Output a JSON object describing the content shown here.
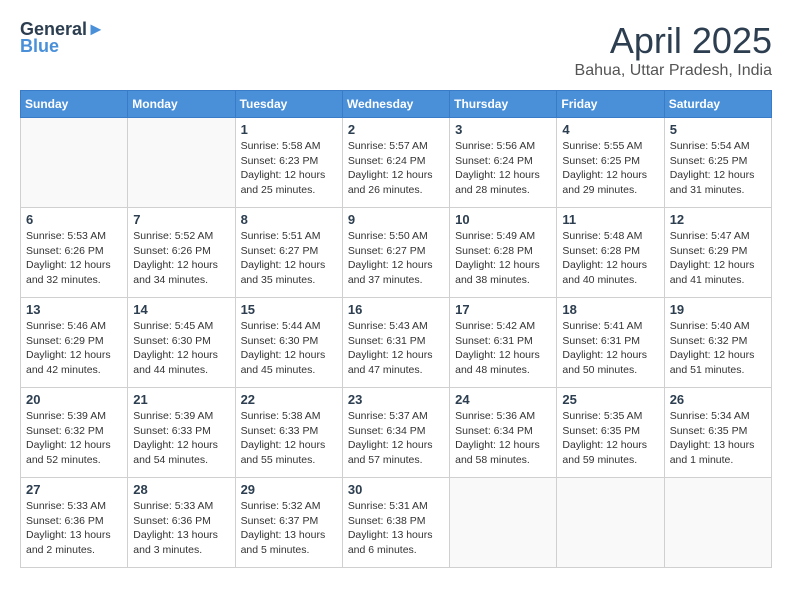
{
  "logo": {
    "line1": "General",
    "line2": "Blue"
  },
  "title": "April 2025",
  "subtitle": "Bahua, Uttar Pradesh, India",
  "days_header": [
    "Sunday",
    "Monday",
    "Tuesday",
    "Wednesday",
    "Thursday",
    "Friday",
    "Saturday"
  ],
  "weeks": [
    [
      {
        "day": "",
        "info": ""
      },
      {
        "day": "",
        "info": ""
      },
      {
        "day": "1",
        "info": "Sunrise: 5:58 AM\nSunset: 6:23 PM\nDaylight: 12 hours\nand 25 minutes."
      },
      {
        "day": "2",
        "info": "Sunrise: 5:57 AM\nSunset: 6:24 PM\nDaylight: 12 hours\nand 26 minutes."
      },
      {
        "day": "3",
        "info": "Sunrise: 5:56 AM\nSunset: 6:24 PM\nDaylight: 12 hours\nand 28 minutes."
      },
      {
        "day": "4",
        "info": "Sunrise: 5:55 AM\nSunset: 6:25 PM\nDaylight: 12 hours\nand 29 minutes."
      },
      {
        "day": "5",
        "info": "Sunrise: 5:54 AM\nSunset: 6:25 PM\nDaylight: 12 hours\nand 31 minutes."
      }
    ],
    [
      {
        "day": "6",
        "info": "Sunrise: 5:53 AM\nSunset: 6:26 PM\nDaylight: 12 hours\nand 32 minutes."
      },
      {
        "day": "7",
        "info": "Sunrise: 5:52 AM\nSunset: 6:26 PM\nDaylight: 12 hours\nand 34 minutes."
      },
      {
        "day": "8",
        "info": "Sunrise: 5:51 AM\nSunset: 6:27 PM\nDaylight: 12 hours\nand 35 minutes."
      },
      {
        "day": "9",
        "info": "Sunrise: 5:50 AM\nSunset: 6:27 PM\nDaylight: 12 hours\nand 37 minutes."
      },
      {
        "day": "10",
        "info": "Sunrise: 5:49 AM\nSunset: 6:28 PM\nDaylight: 12 hours\nand 38 minutes."
      },
      {
        "day": "11",
        "info": "Sunrise: 5:48 AM\nSunset: 6:28 PM\nDaylight: 12 hours\nand 40 minutes."
      },
      {
        "day": "12",
        "info": "Sunrise: 5:47 AM\nSunset: 6:29 PM\nDaylight: 12 hours\nand 41 minutes."
      }
    ],
    [
      {
        "day": "13",
        "info": "Sunrise: 5:46 AM\nSunset: 6:29 PM\nDaylight: 12 hours\nand 42 minutes."
      },
      {
        "day": "14",
        "info": "Sunrise: 5:45 AM\nSunset: 6:30 PM\nDaylight: 12 hours\nand 44 minutes."
      },
      {
        "day": "15",
        "info": "Sunrise: 5:44 AM\nSunset: 6:30 PM\nDaylight: 12 hours\nand 45 minutes."
      },
      {
        "day": "16",
        "info": "Sunrise: 5:43 AM\nSunset: 6:31 PM\nDaylight: 12 hours\nand 47 minutes."
      },
      {
        "day": "17",
        "info": "Sunrise: 5:42 AM\nSunset: 6:31 PM\nDaylight: 12 hours\nand 48 minutes."
      },
      {
        "day": "18",
        "info": "Sunrise: 5:41 AM\nSunset: 6:31 PM\nDaylight: 12 hours\nand 50 minutes."
      },
      {
        "day": "19",
        "info": "Sunrise: 5:40 AM\nSunset: 6:32 PM\nDaylight: 12 hours\nand 51 minutes."
      }
    ],
    [
      {
        "day": "20",
        "info": "Sunrise: 5:39 AM\nSunset: 6:32 PM\nDaylight: 12 hours\nand 52 minutes."
      },
      {
        "day": "21",
        "info": "Sunrise: 5:39 AM\nSunset: 6:33 PM\nDaylight: 12 hours\nand 54 minutes."
      },
      {
        "day": "22",
        "info": "Sunrise: 5:38 AM\nSunset: 6:33 PM\nDaylight: 12 hours\nand 55 minutes."
      },
      {
        "day": "23",
        "info": "Sunrise: 5:37 AM\nSunset: 6:34 PM\nDaylight: 12 hours\nand 57 minutes."
      },
      {
        "day": "24",
        "info": "Sunrise: 5:36 AM\nSunset: 6:34 PM\nDaylight: 12 hours\nand 58 minutes."
      },
      {
        "day": "25",
        "info": "Sunrise: 5:35 AM\nSunset: 6:35 PM\nDaylight: 12 hours\nand 59 minutes."
      },
      {
        "day": "26",
        "info": "Sunrise: 5:34 AM\nSunset: 6:35 PM\nDaylight: 13 hours\nand 1 minute."
      }
    ],
    [
      {
        "day": "27",
        "info": "Sunrise: 5:33 AM\nSunset: 6:36 PM\nDaylight: 13 hours\nand 2 minutes."
      },
      {
        "day": "28",
        "info": "Sunrise: 5:33 AM\nSunset: 6:36 PM\nDaylight: 13 hours\nand 3 minutes."
      },
      {
        "day": "29",
        "info": "Sunrise: 5:32 AM\nSunset: 6:37 PM\nDaylight: 13 hours\nand 5 minutes."
      },
      {
        "day": "30",
        "info": "Sunrise: 5:31 AM\nSunset: 6:38 PM\nDaylight: 13 hours\nand 6 minutes."
      },
      {
        "day": "",
        "info": ""
      },
      {
        "day": "",
        "info": ""
      },
      {
        "day": "",
        "info": ""
      }
    ]
  ]
}
